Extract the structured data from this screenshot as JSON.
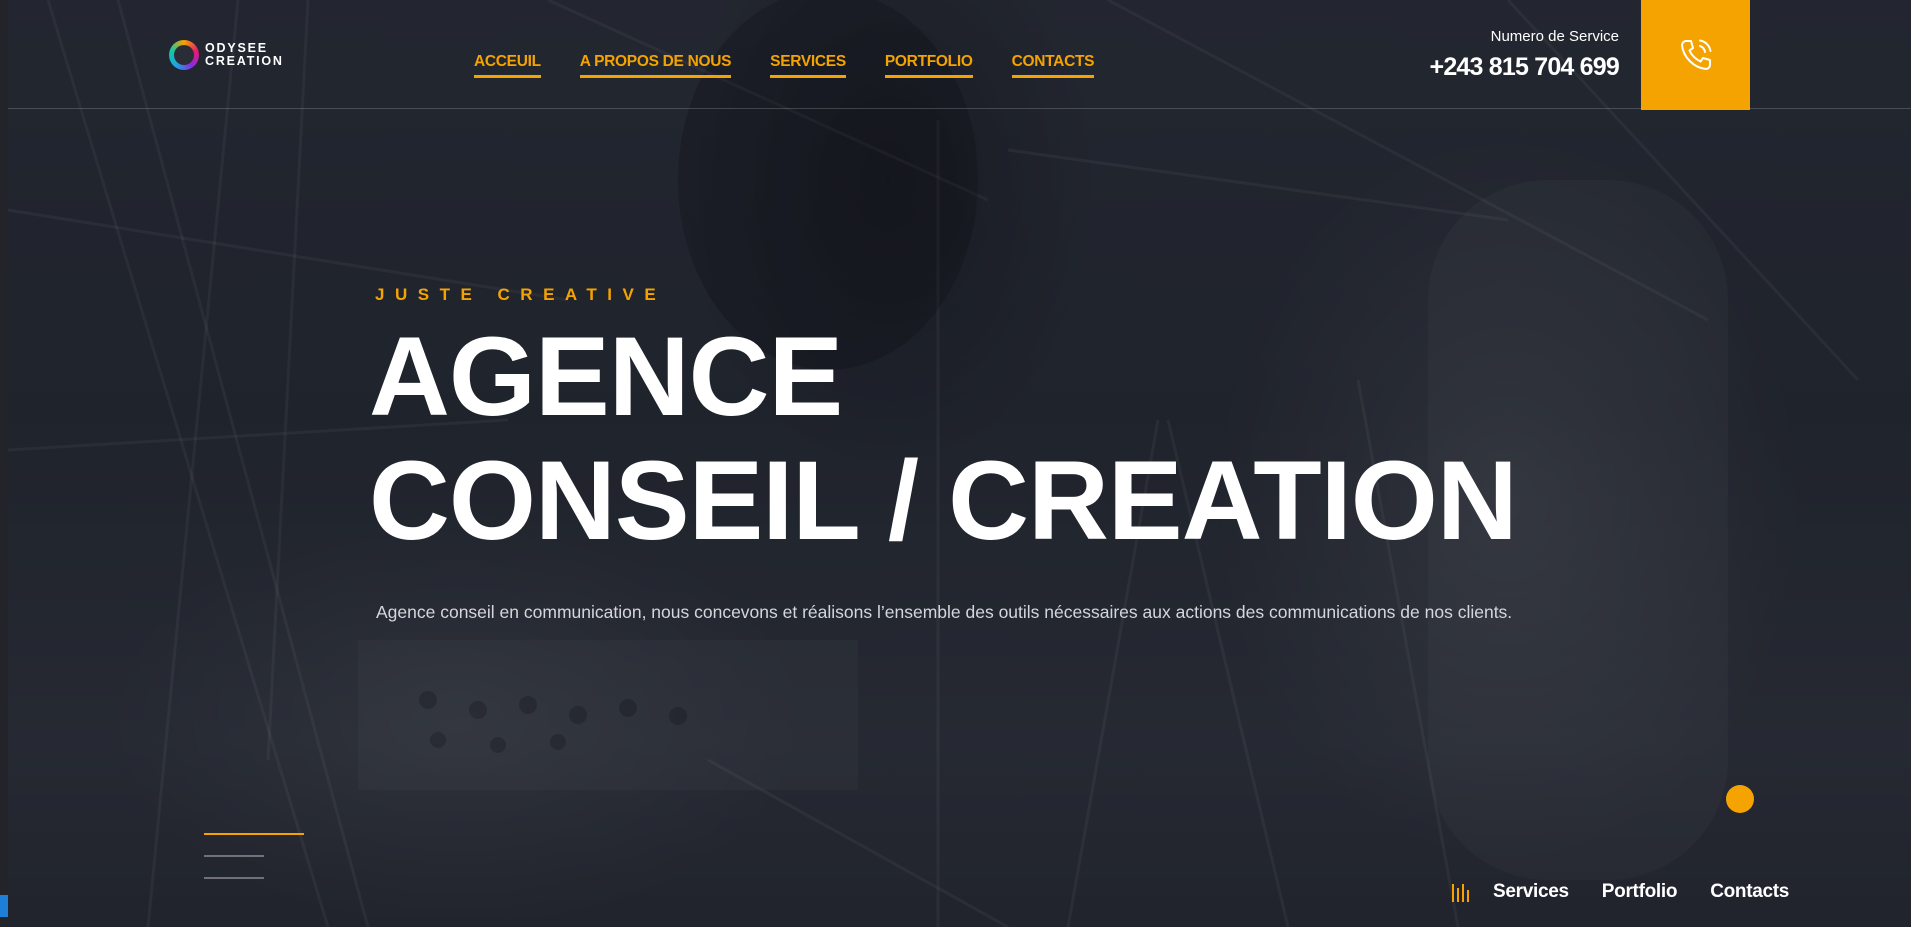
{
  "brand": {
    "logo_line1": "ODYSEE",
    "logo_line2": "CREATION",
    "accent_color": "#f5a300"
  },
  "nav": {
    "items": [
      {
        "label": "ACCEUIL"
      },
      {
        "label": "A PROPOS DE NOUS"
      },
      {
        "label": "SERVICES"
      },
      {
        "label": "PORTFOLIO"
      },
      {
        "label": "CONTACTS"
      }
    ]
  },
  "contact": {
    "label": "Numero de Service",
    "phone": "+243 815 704 699",
    "icon": "phone-icon"
  },
  "hero": {
    "tagline": "JUSTE CREATIVE",
    "title_line1": "AGENCE",
    "title_line2": "CONSEIL / CREATION",
    "description": "Agence conseil en communication, nous concevons et réalisons l’ensemble des outils nécessaires aux actions des communications de nos clients."
  },
  "bottom_nav": {
    "icon": "bars-icon",
    "links": [
      {
        "label": "Services"
      },
      {
        "label": "Portfolio"
      },
      {
        "label": "Contacts"
      }
    ]
  }
}
